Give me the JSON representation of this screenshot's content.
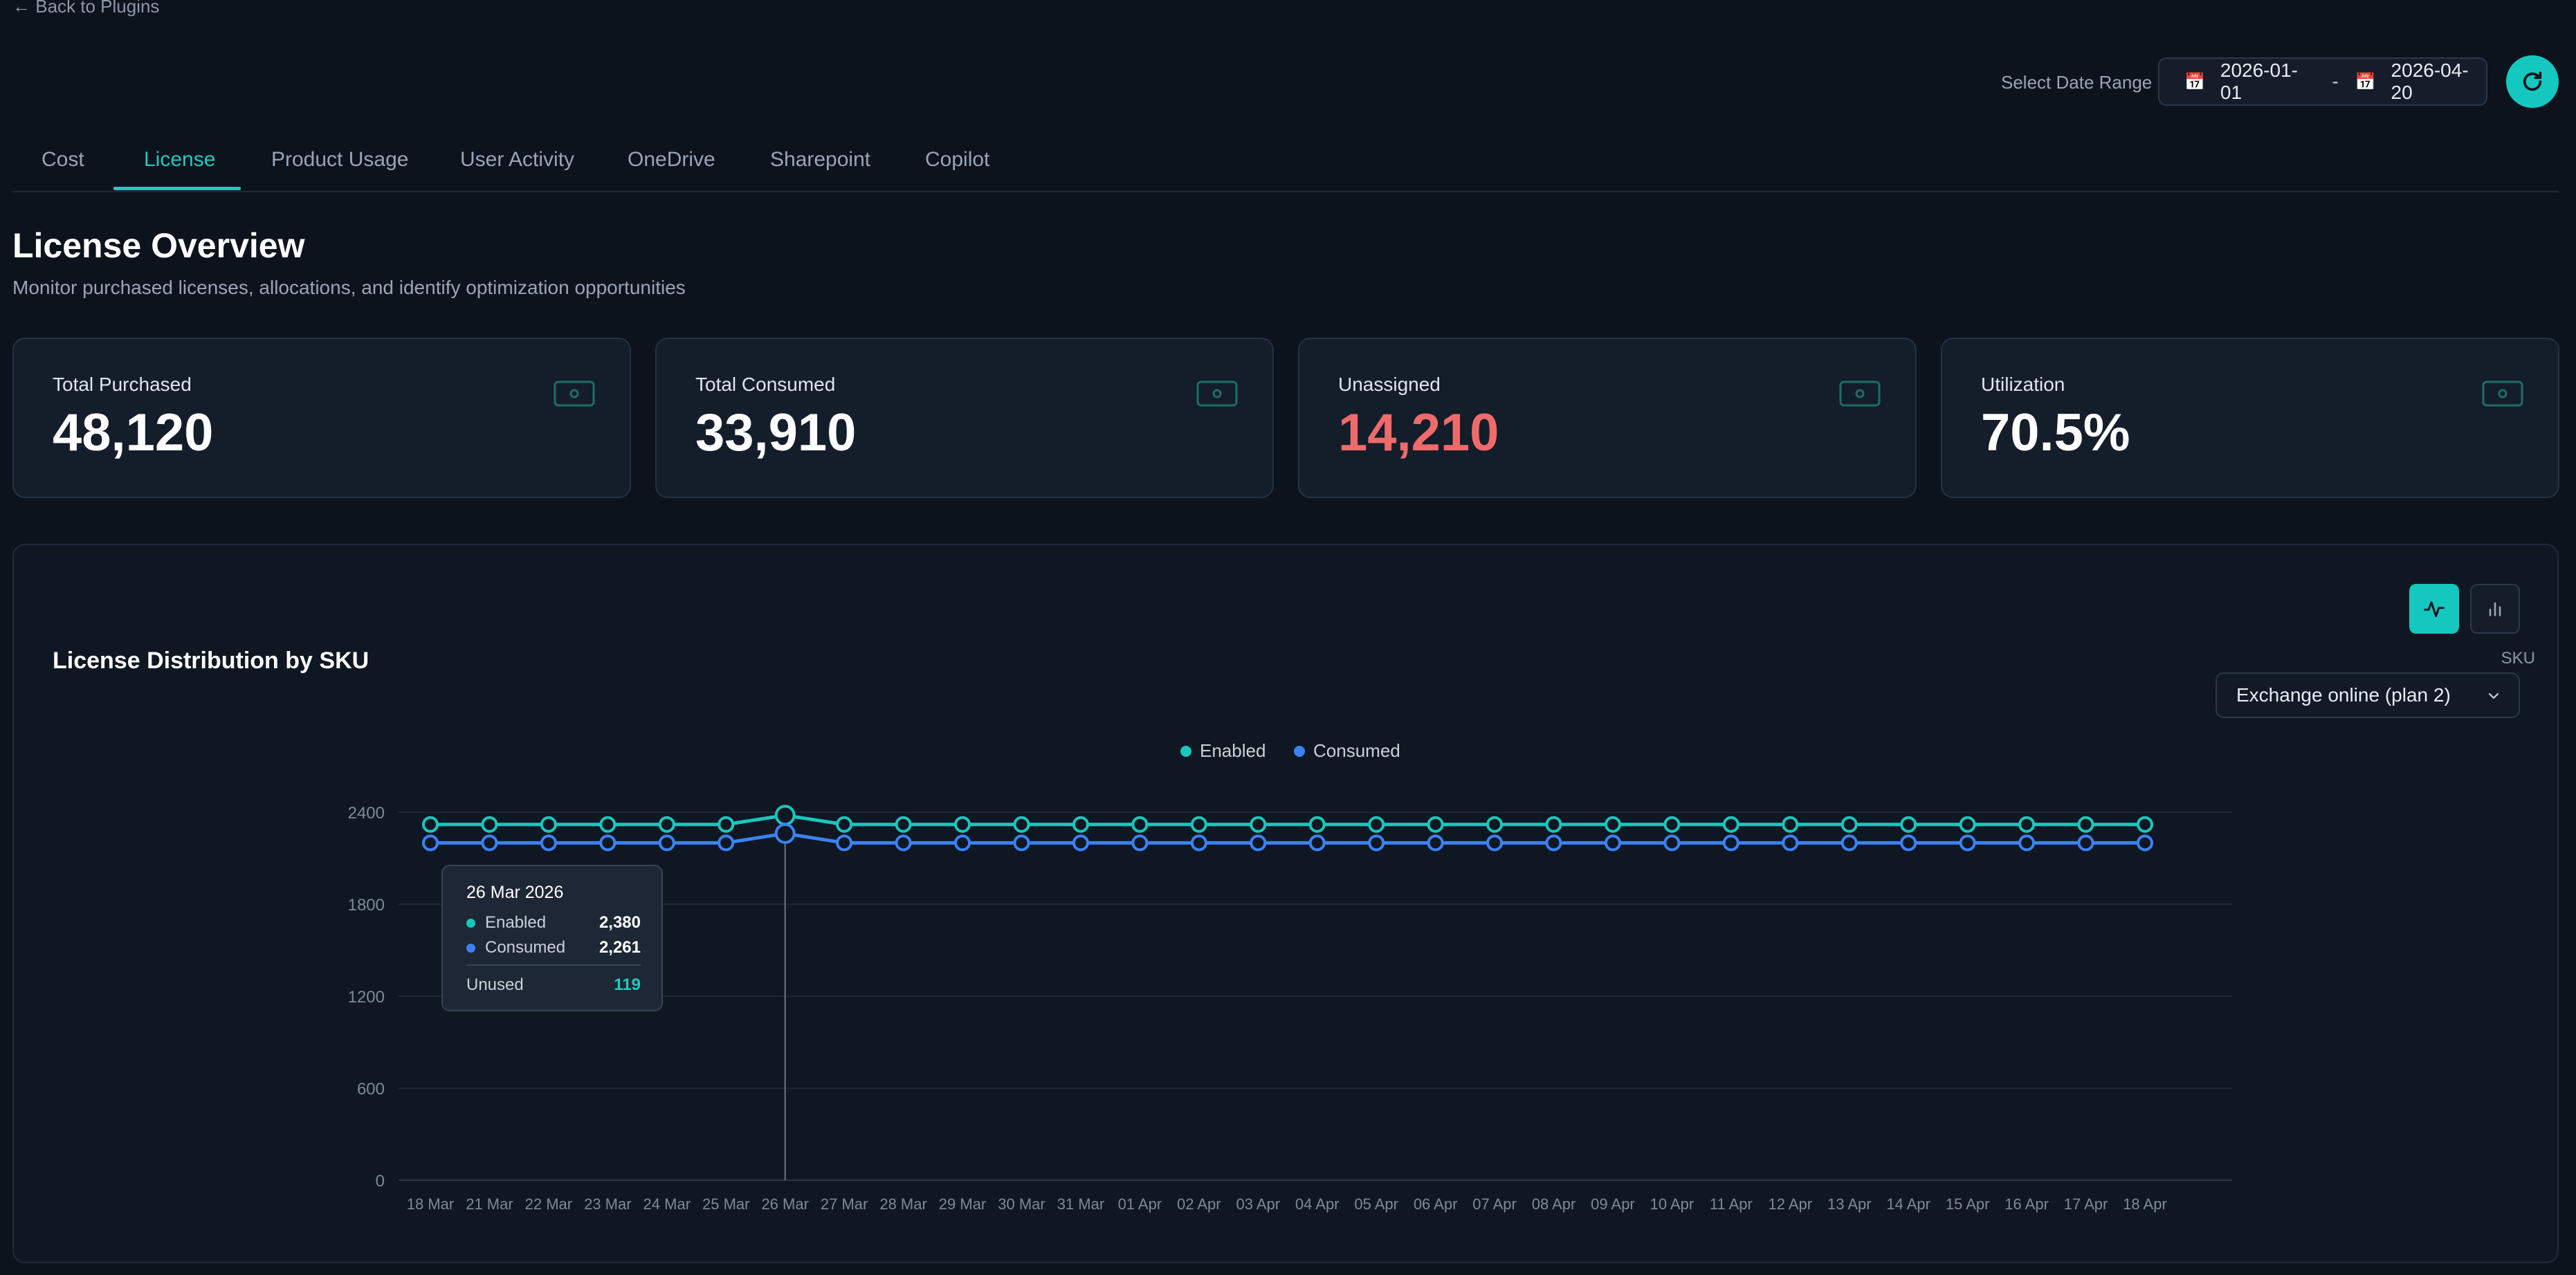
{
  "nav": {
    "back_label": "← Back to Plugins"
  },
  "date_range": {
    "label": "Select Date Range",
    "start": "2026-01-01",
    "separator": "-",
    "end": "2026-04-20"
  },
  "tabs": [
    {
      "label": "Cost"
    },
    {
      "label": "License",
      "active": true
    },
    {
      "label": "Product Usage"
    },
    {
      "label": "User Activity"
    },
    {
      "label": "OneDrive"
    },
    {
      "label": "Sharepoint"
    },
    {
      "label": "Copilot"
    }
  ],
  "page": {
    "title": "License Overview",
    "subtitle": "Monitor purchased licenses, allocations, and identify optimization opportunities"
  },
  "stats": [
    {
      "label": "Total Purchased",
      "value": "48,120"
    },
    {
      "label": "Total Consumed",
      "value": "33,910"
    },
    {
      "label": "Unassigned",
      "value": "14,210"
    },
    {
      "label": "Utilization",
      "value": "70.5%"
    }
  ],
  "panel": {
    "title": "License Distribution by SKU",
    "sku_label": "SKU",
    "sku_selected": "Exchange online (plan 2)"
  },
  "colors": {
    "accent": "#22c9bd",
    "enabled": "#19c7bd",
    "consumed": "#3b82f6",
    "negative": "#ef6b6b"
  },
  "chart_data": {
    "type": "line",
    "legend": [
      "Enabled",
      "Consumed"
    ],
    "legend_position": "top-center",
    "x": [
      "18 Mar",
      "21 Mar",
      "22 Mar",
      "23 Mar",
      "24 Mar",
      "25 Mar",
      "26 Mar",
      "27 Mar",
      "28 Mar",
      "29 Mar",
      "30 Mar",
      "31 Mar",
      "01 Apr",
      "02 Apr",
      "03 Apr",
      "04 Apr",
      "05 Apr",
      "06 Apr",
      "07 Apr",
      "08 Apr",
      "09 Apr",
      "10 Apr",
      "11 Apr",
      "12 Apr",
      "13 Apr",
      "14 Apr",
      "15 Apr",
      "16 Apr",
      "17 Apr",
      "18 Apr"
    ],
    "series": [
      {
        "name": "Enabled",
        "values": [
          2320,
          2320,
          2320,
          2320,
          2320,
          2320,
          2380,
          2320,
          2320,
          2320,
          2320,
          2320,
          2320,
          2320,
          2320,
          2320,
          2320,
          2320,
          2320,
          2320,
          2320,
          2320,
          2320,
          2320,
          2320,
          2320,
          2320,
          2320,
          2320,
          2320
        ]
      },
      {
        "name": "Consumed",
        "values": [
          2200,
          2200,
          2200,
          2200,
          2200,
          2200,
          2261,
          2200,
          2200,
          2200,
          2200,
          2200,
          2200,
          2200,
          2200,
          2200,
          2200,
          2200,
          2200,
          2200,
          2200,
          2200,
          2200,
          2200,
          2200,
          2200,
          2200,
          2200,
          2200,
          2200
        ]
      }
    ],
    "y_ticks": [
      "0",
      "600",
      "1200",
      "1800",
      "2400"
    ],
    "ylim": [
      0,
      2700
    ],
    "grid": true,
    "tooltip": {
      "date": "26 Mar 2026",
      "rows": [
        {
          "name": "Enabled",
          "value": "2,380"
        },
        {
          "name": "Consumed",
          "value": "2,261"
        }
      ],
      "unused_label": "Unused",
      "unused_value": "119"
    }
  }
}
